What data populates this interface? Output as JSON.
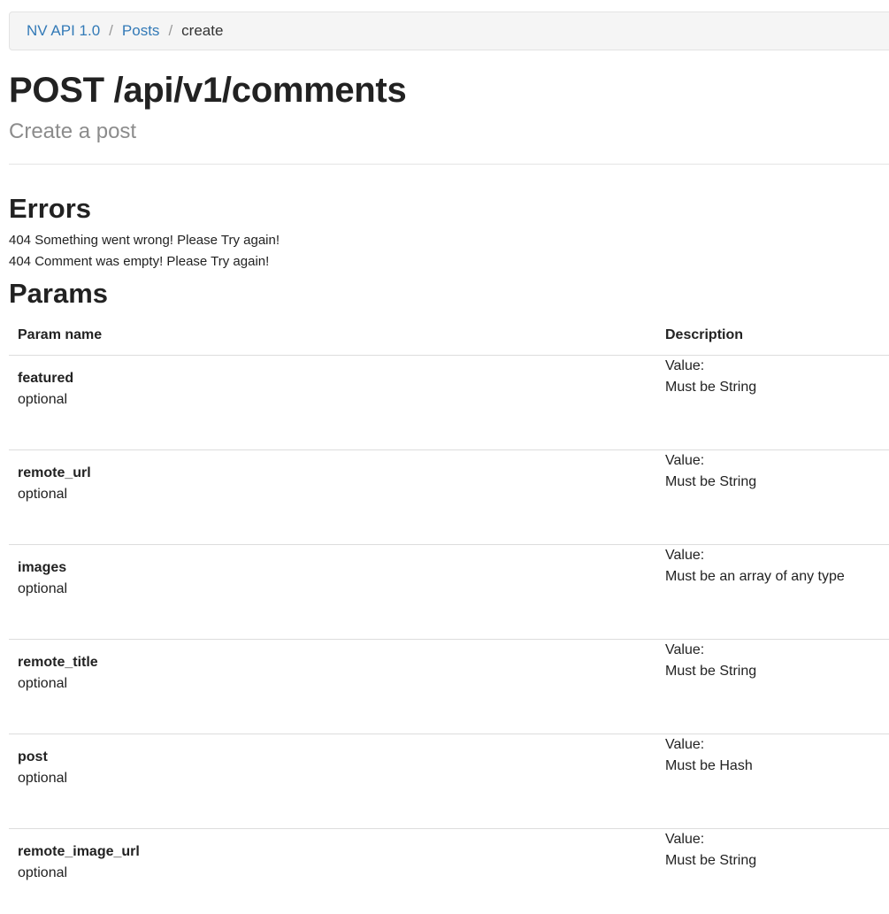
{
  "breadcrumb": {
    "items": [
      {
        "label": "NV API 1.0"
      },
      {
        "label": "Posts"
      }
    ],
    "current": "create",
    "separator": "/"
  },
  "header": {
    "title": "POST /api/v1/comments",
    "subtitle": "Create a post"
  },
  "errors": {
    "heading": "Errors",
    "items": [
      "404 Something went wrong! Please Try again!",
      "404 Comment was empty! Please Try again!"
    ]
  },
  "params": {
    "heading": "Params",
    "columns": [
      "Param name",
      "Description"
    ],
    "rows": [
      {
        "name": "featured",
        "required": "optional",
        "value_label": "Value:",
        "type": "Must be String"
      },
      {
        "name": "remote_url",
        "required": "optional",
        "value_label": "Value:",
        "type": "Must be String"
      },
      {
        "name": "images",
        "required": "optional",
        "value_label": "Value:",
        "type": "Must be an array of any type"
      },
      {
        "name": "remote_title",
        "required": "optional",
        "value_label": "Value:",
        "type": "Must be String"
      },
      {
        "name": "post",
        "required": "optional",
        "value_label": "Value:",
        "type": "Must be Hash"
      },
      {
        "name": "remote_image_url",
        "required": "optional",
        "value_label": "Value:",
        "type": "Must be String"
      }
    ]
  },
  "colors": {
    "link": "#337ab7",
    "text": "#222222",
    "muted": "#8c8c8c",
    "breadcrumb_bg": "#f5f5f5",
    "border": "#dddddd"
  }
}
